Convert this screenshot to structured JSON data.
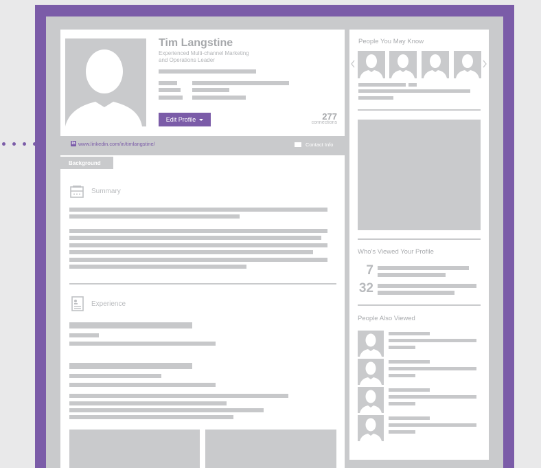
{
  "profile": {
    "name": "Tim Langstine",
    "headline_line1": "Experienced Multi-channel Marketing",
    "headline_line2": "and Operations Leader",
    "edit_button": "Edit Profile",
    "connections_count": "277",
    "connections_label": "connections",
    "url": "www.linkedin.com/in/timlangstine/",
    "contact_info": "Contact Info"
  },
  "tabs": {
    "background": "Background"
  },
  "sections": {
    "summary": "Summary",
    "experience": "Experience"
  },
  "sidebar": {
    "people_you_may_know": "People You May Know",
    "whos_viewed": "Who's Viewed Your Profile",
    "viewed_count": "7",
    "search_count": "32",
    "people_also_viewed": "People Also Viewed"
  },
  "colors": {
    "accent": "#7b5ca8",
    "placeholder": "#c9cacc",
    "text_muted": "#a6a8ab"
  },
  "icons": {
    "linkedin": "linkedin-icon",
    "contact": "contact-card-icon",
    "summary": "summary-icon",
    "experience": "experience-icon",
    "carousel_prev": "chevron-left-icon",
    "carousel_next": "chevron-right-icon",
    "dropdown": "caret-down-icon"
  }
}
